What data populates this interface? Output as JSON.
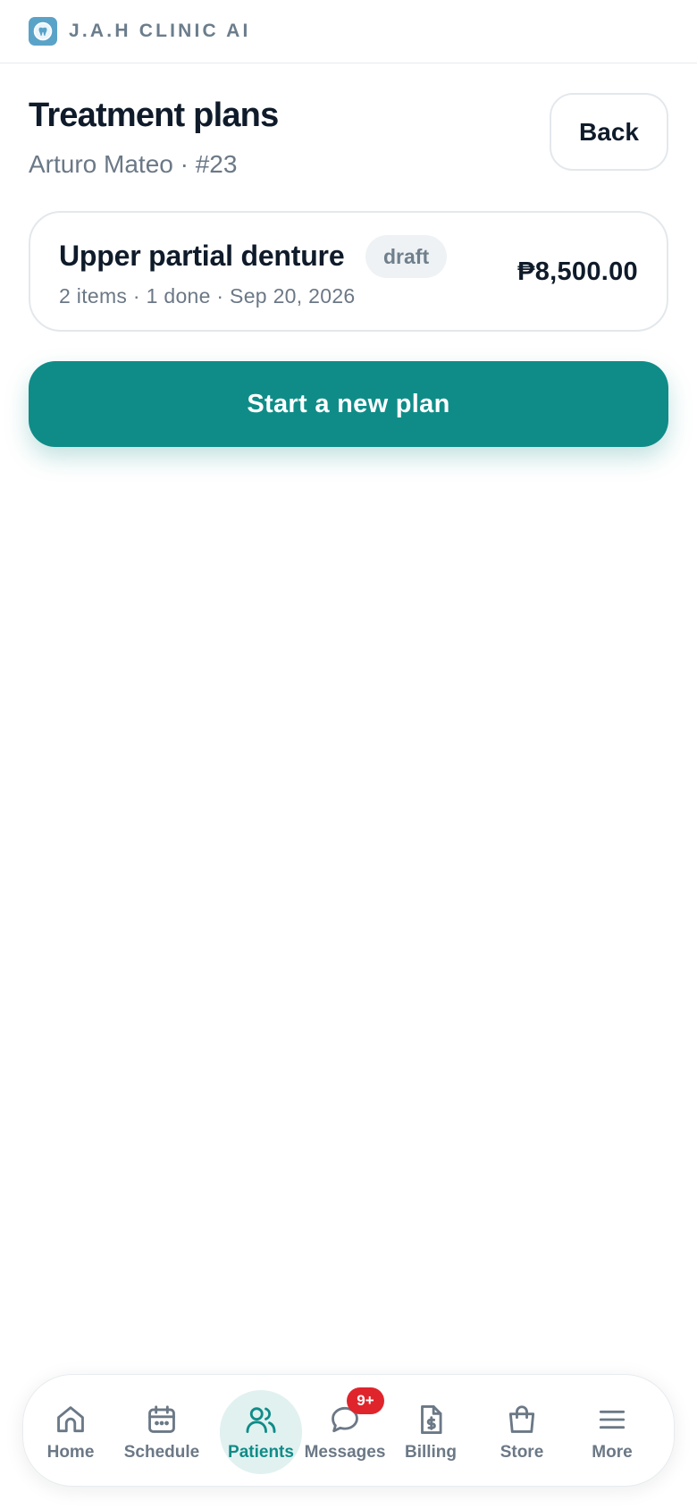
{
  "app": {
    "brand_name": "J.A.H CLINIC AI",
    "brand_logo_icon": "tooth-logo-icon",
    "brand_color": "#5aa3c8"
  },
  "header": {
    "title": "Treatment plans",
    "subtitle": "Arturo Mateo · #23",
    "back_label": "Back"
  },
  "plans": [
    {
      "name": "Upper partial denture",
      "status": "draft",
      "meta": "2 items · 1 done · Sep 20, 2026",
      "total": "₱8,500.00"
    }
  ],
  "actions": {
    "new_plan_label": "Start a new plan"
  },
  "nav": {
    "items": [
      {
        "label": "Home",
        "icon": "home-icon"
      },
      {
        "label": "Schedule",
        "icon": "calendar-icon"
      },
      {
        "label": "Patients",
        "icon": "users-icon",
        "active": true
      },
      {
        "label": "Messages",
        "icon": "chat-bubble-icon",
        "badge": "9+"
      },
      {
        "label": "Billing",
        "icon": "invoice-icon"
      },
      {
        "label": "Store",
        "icon": "shopping-bag-icon"
      },
      {
        "label": "More",
        "icon": "menu-icon"
      }
    ]
  },
  "colors": {
    "accent": "#0f8c88",
    "accent_soft": "#e1f1f0",
    "badge_red": "#e0242c",
    "text_primary": "#0f1b2a",
    "text_muted": "#6b7886"
  }
}
